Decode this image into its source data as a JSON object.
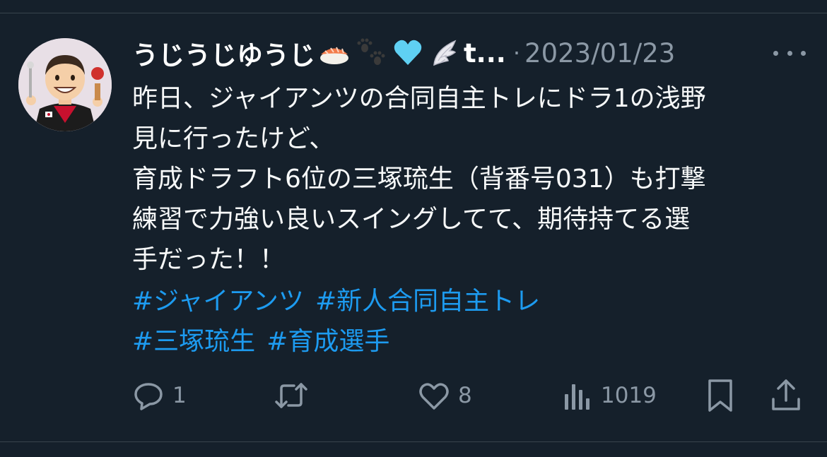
{
  "tweet": {
    "display_name": "うじうじゆうじ",
    "name_emojis": [
      "sushi-emoji",
      "paw-prints-emoji",
      "light-blue-heart-emoji",
      "wing-emoji"
    ],
    "name_truncated": "t...",
    "separator": "·",
    "timestamp": "2023/01/23",
    "body_lines": [
      "昨日、ジャイアンツの合同自主トレにドラ1の浅野",
      "見に行ったけど、",
      "育成ドラフト6位の三塚琉生（背番号031）も打撃",
      "練習で力強い良いスイングしてて、期待持てる選",
      "手だった！！"
    ],
    "hashtags_line1": [
      "#ジャイアンツ",
      "#新人合同自主トレ"
    ],
    "hashtags_line2": [
      "#三塚琉生",
      "#育成選手"
    ],
    "actions": {
      "reply_count": "1",
      "retweet_count": "",
      "like_count": "8",
      "views_count": "1019"
    },
    "icons": {
      "reply": "reply-icon",
      "retweet": "retweet-icon",
      "like": "heart-icon",
      "views": "views-icon",
      "bookmark": "bookmark-icon",
      "share": "share-icon",
      "more": "more-icon"
    },
    "colors": {
      "background": "#15202b",
      "text": "#f7f9f9",
      "secondary": "#8b98a5",
      "accent": "#1d9bf0",
      "divider": "#38444d"
    }
  }
}
